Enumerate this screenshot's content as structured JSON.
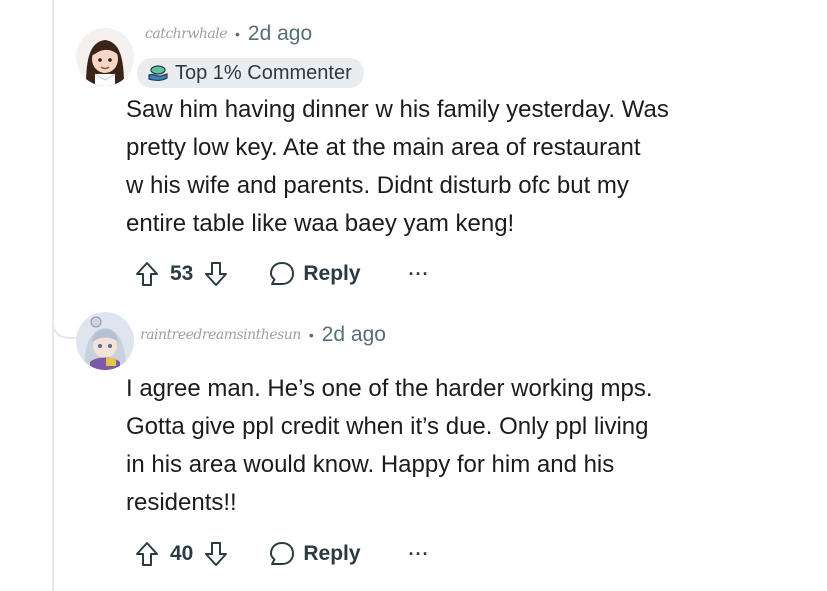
{
  "comments": [
    {
      "username": "catchrwhale",
      "age": "2d ago",
      "flair": "Top 1% Commenter",
      "flair_icon": "hand-coin-icon",
      "body": [
        "Saw him having dinner w his family yesterday. Was",
        "pretty low key. Ate at the main area of restaurant",
        "w his wife and parents. Didnt disturb ofc but my",
        "entire table like waa baey yam keng!"
      ],
      "score": "53",
      "reply_label": "Reply",
      "more_label": "···"
    },
    {
      "username": "raintreedreamsinthesun",
      "age": "2d ago",
      "body": [
        "I agree man. He’s one of the harder working mps.",
        "Gotta give ppl credit when it’s due. Only ppl living",
        "in his area would know. Happy for him and his",
        "residents!!"
      ],
      "score": "40",
      "reply_label": "Reply",
      "more_label": "···"
    }
  ],
  "colors": {
    "thread_line": "#e6e8ea",
    "flair_bg": "#eaedef",
    "meta_text": "#576f76",
    "action_text": "#2a3c42",
    "body_text": "#1c1c1c"
  }
}
